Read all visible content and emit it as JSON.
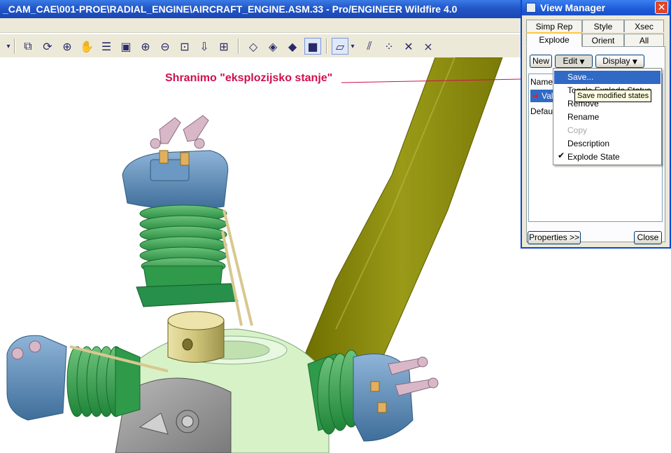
{
  "window": {
    "title": "_CAM_CAE\\001-PROE\\RADIAL_ENGINE\\AIRCRAFT_ENGINE.ASM.33 - Pro/ENGINEER Wildfire 4.0"
  },
  "toolbar": {
    "icons": [
      "dropdown-arrow-icon",
      "layer-icon",
      "datum-axis-icon",
      "spin-center-icon",
      "pan-hand-icon",
      "layers-stack-icon",
      "saved-view-icon",
      "zoom-in-icon",
      "zoom-out-icon",
      "refit-icon",
      "reorient-icon",
      "named-views-icon",
      "wireframe-icon",
      "hidden-line-icon",
      "no-hidden-icon",
      "shading-icon",
      "datum-planes-icon",
      "datum-planes-dropdown-icon",
      "datum-axes-icon",
      "datum-points-icon",
      "coordinate-systems-icon"
    ]
  },
  "annotation": {
    "text": "Shranimo \"eksplozijsko stanje\"",
    "color": "#d0104c"
  },
  "view_manager": {
    "title": "View Manager",
    "tabs_row1": [
      "Simp Rep",
      "Style",
      "Xsec"
    ],
    "tabs_row2": [
      "Explode",
      "Orient",
      "All"
    ],
    "active_tab": "Explode",
    "buttons": {
      "new": "New",
      "edit": "Edit",
      "display": "Display"
    },
    "names_header": "Names",
    "names": [
      "Vali",
      "Default"
    ],
    "footer": {
      "properties": "Properties >>",
      "close": "Close"
    }
  },
  "edit_menu": {
    "items": [
      {
        "label": "Save...",
        "state": "highlighted"
      },
      {
        "label": "Toggle Explode Status",
        "state": "normal"
      },
      {
        "label": "Remove",
        "state": "normal"
      },
      {
        "label": "Rename",
        "state": "normal"
      },
      {
        "label": "Copy",
        "state": "disabled"
      },
      {
        "label": "Description",
        "state": "normal"
      },
      {
        "label": "Explode State",
        "state": "checked"
      }
    ]
  },
  "tooltip": {
    "text": "Save modified states"
  },
  "colors": {
    "titlebar": "#2356c6",
    "cylinder_head": "#5a8cb8",
    "cylinder_fins": "#2e9a4a",
    "propeller": "#8a8a10",
    "crankcase": "#d8f2c8",
    "piston": "#d2c98a",
    "rocker_arms": "#d8b8c8"
  }
}
